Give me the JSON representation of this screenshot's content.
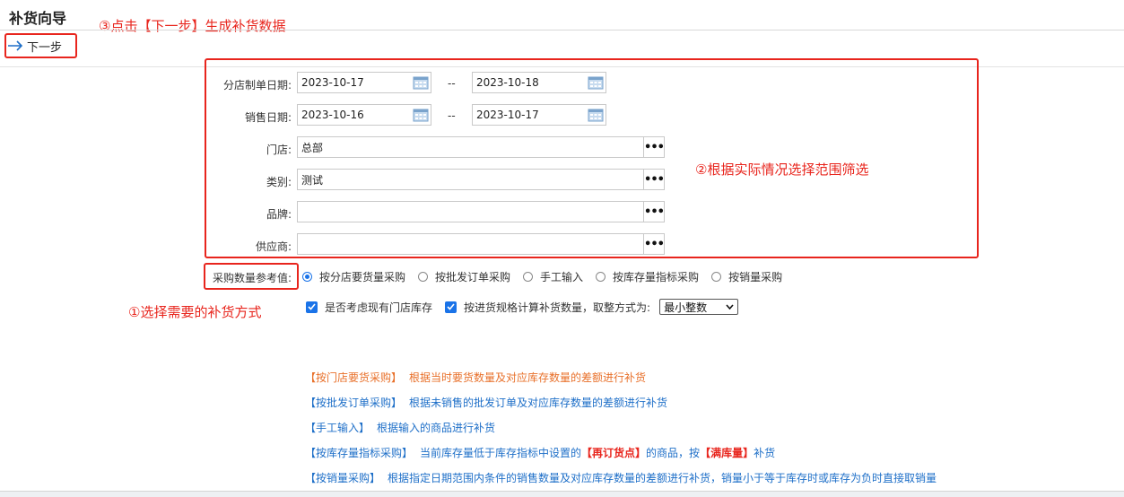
{
  "page": {
    "title": "补货向导"
  },
  "toolbar": {
    "next_label": "下一步"
  },
  "annotations": {
    "step3": "③点击【下一步】生成补货数据",
    "step2": "②根据实际情况选择范围筛选",
    "step1": "①选择需要的补货方式"
  },
  "form": {
    "branch_date": {
      "label": "分店制单日期:",
      "from": "2023-10-17",
      "to": "2023-10-18"
    },
    "sales_date": {
      "label": "销售日期:",
      "from": "2023-10-16",
      "to": "2023-10-17"
    },
    "range_sep": "--",
    "store": {
      "label": "门店:",
      "value": "总部"
    },
    "category": {
      "label": "类别:",
      "value": "测试"
    },
    "brand": {
      "label": "品牌:",
      "value": ""
    },
    "supplier": {
      "label": "供应商:",
      "value": ""
    },
    "more_button": "•••"
  },
  "purchase": {
    "label": "采购数量参考值:",
    "options": [
      {
        "label": "按分店要货量采购",
        "selected": true
      },
      {
        "label": "按批发订单采购",
        "selected": false
      },
      {
        "label": "手工输入",
        "selected": false
      },
      {
        "label": "按库存量指标采购",
        "selected": false
      },
      {
        "label": "按销量采购",
        "selected": false
      }
    ],
    "consider_stock": {
      "label": "是否考虑现有门店库存",
      "checked": true
    },
    "by_spec": {
      "label": "按进货规格计算补货数量，取整方式为:",
      "checked": true
    },
    "rounding": {
      "selected": "最小整数"
    }
  },
  "descriptions": [
    {
      "key": "【按门店要货采购】",
      "text": "根据当时要货数量及对应库存数量的差额进行补货"
    },
    {
      "key": "【按批发订单采购】",
      "text": "根据未销售的批发订单及对应库存数量的差额进行补货"
    },
    {
      "key": "【手工输入】",
      "text": "根据输入的商品进行补货"
    },
    {
      "key": "【按库存量指标采购】",
      "text_a": "当前库存量低于库存指标中设置的",
      "hl1": "【再订货点】",
      "text_b": "的商品，按",
      "hl2": "【满库量】",
      "text_c": "补货"
    },
    {
      "key": "【按销量采购】",
      "text": "根据指定日期范围内条件的销售数量及对应库存数量的差额进行补货，销量小于等于库存时或库存为负时直接取销量"
    }
  ],
  "colors": {
    "accent": "#1a73e8",
    "annotation_red": "#e8251d",
    "desc_blue": "#1e6fc8",
    "desc_orange": "#e8702a"
  }
}
